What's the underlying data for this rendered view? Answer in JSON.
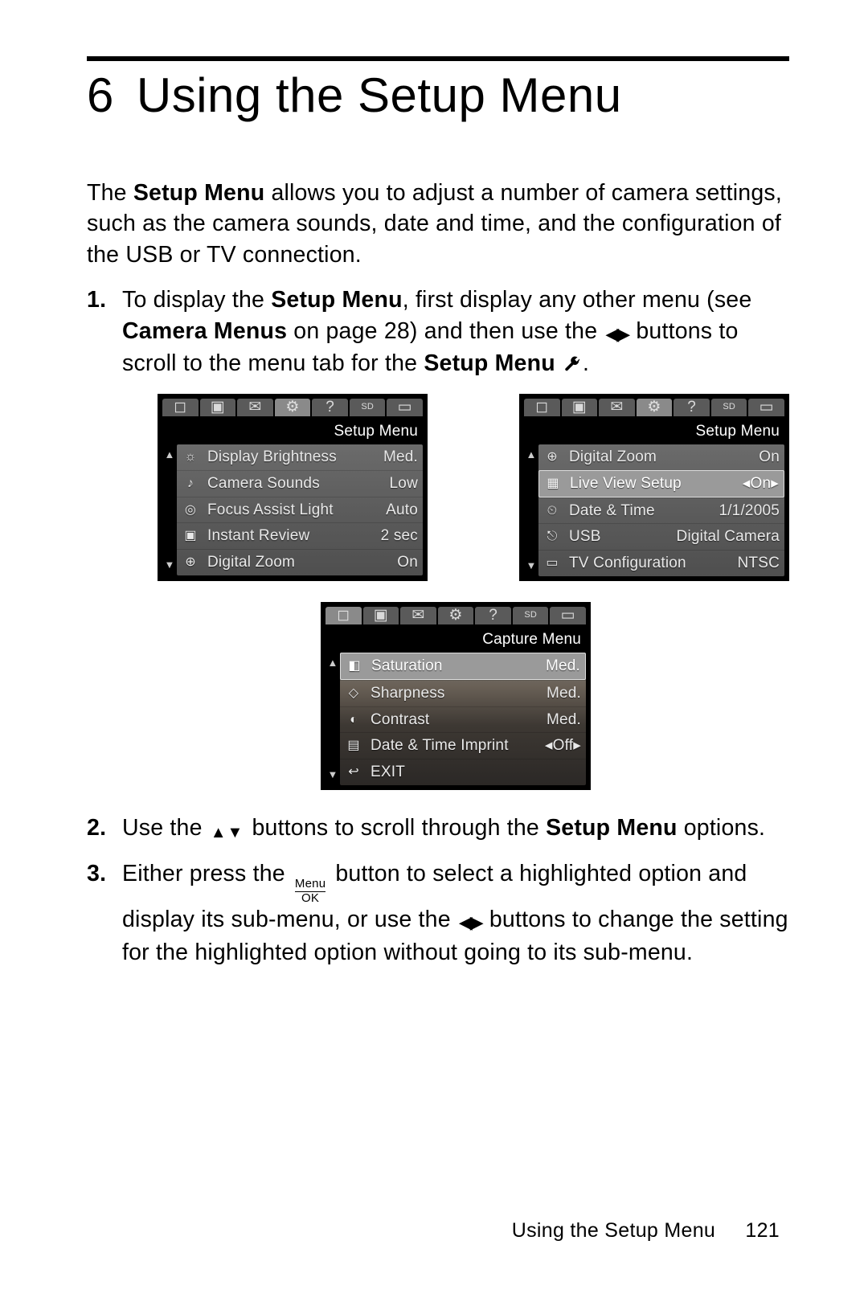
{
  "chapter": {
    "number": "6",
    "title": "Using the Setup Menu"
  },
  "intro": {
    "t1": "The ",
    "b1": "Setup Menu",
    "t2": " allows you to adjust a number of camera settings, such as the camera sounds, date and time, and the configuration of the USB or TV connection."
  },
  "step1": {
    "t1": "To display the ",
    "b1": "Setup Menu",
    "t2": ", first display any other menu (see ",
    "b2": "Camera Menus",
    "t3": " on page 28) and then use the ",
    "t4": " buttons to scroll to the menu tab for the ",
    "b3": "Setup Menu",
    "t5": " ",
    "t6": "."
  },
  "step2": {
    "t1": "Use the ",
    "t2": " buttons to scroll through the ",
    "b1": "Setup Menu",
    "t3": " options."
  },
  "step3": {
    "t1": "Either press the ",
    "menu_top": "Menu",
    "menu_bot": "OK",
    "t2": " button to select a highlighted option and display its sub-menu, or use the ",
    "t3": " buttons to change the setting for the highlighted option without going to its sub-menu."
  },
  "lcd_left": {
    "title": "Setup Menu",
    "rows": [
      {
        "icon": "brightness",
        "label": "Display Brightness",
        "value": "Med."
      },
      {
        "icon": "sound",
        "label": "Camera Sounds",
        "value": "Low"
      },
      {
        "icon": "focus",
        "label": "Focus Assist Light",
        "value": "Auto"
      },
      {
        "icon": "review",
        "label": "Instant Review",
        "value": "2 sec"
      },
      {
        "icon": "zoom",
        "label": "Digital Zoom",
        "value": "On"
      }
    ]
  },
  "lcd_right": {
    "title": "Setup Menu",
    "rows": [
      {
        "icon": "zoom",
        "label": "Digital Zoom",
        "value": "On"
      },
      {
        "icon": "live",
        "label": "Live View Setup",
        "value": "◂On▸",
        "hl": true
      },
      {
        "icon": "clock",
        "label": "Date & Time",
        "value": "1/1/2005"
      },
      {
        "icon": "usb",
        "label": "USB",
        "value": "Digital Camera"
      },
      {
        "icon": "tv",
        "label": "TV Configuration",
        "value": "NTSC"
      }
    ]
  },
  "lcd_center": {
    "title": "Capture Menu",
    "rows": [
      {
        "icon": "sat",
        "label": "Saturation",
        "value": "Med.",
        "hl": true
      },
      {
        "icon": "sharp",
        "label": "Sharpness",
        "value": "Med."
      },
      {
        "icon": "cont",
        "label": "Contrast",
        "value": "Med."
      },
      {
        "icon": "dti",
        "label": "Date & Time Imprint",
        "value": "◂Off▸"
      },
      {
        "icon": "exit",
        "label": "EXIT",
        "value": ""
      }
    ]
  },
  "footer": {
    "label": "Using the Setup Menu",
    "page": "121"
  }
}
